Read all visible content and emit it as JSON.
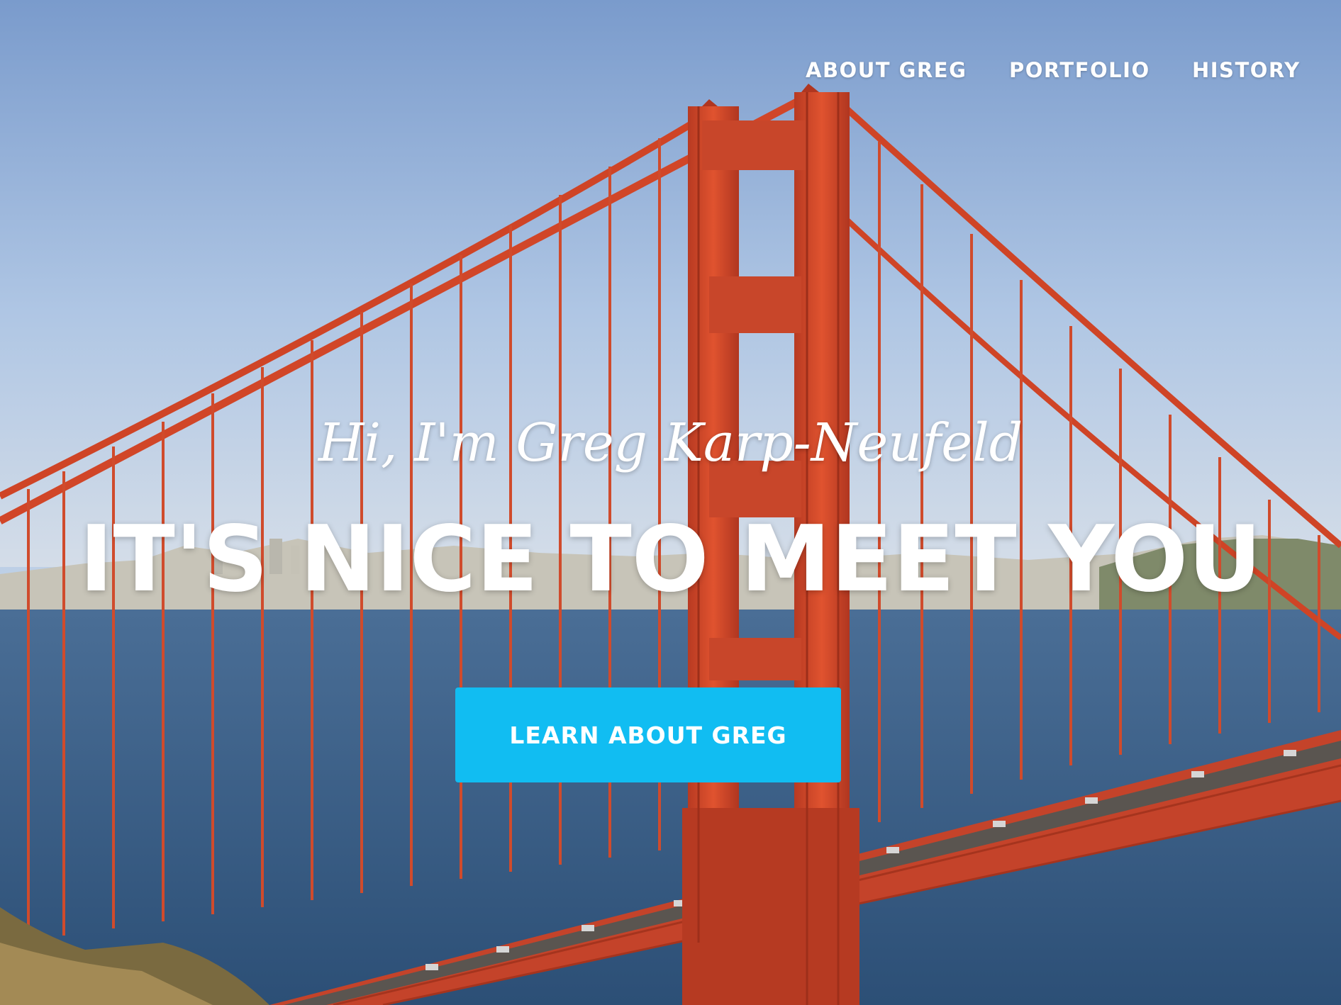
{
  "nav": {
    "items": [
      {
        "label": "ABOUT GREG"
      },
      {
        "label": "PORTFOLIO"
      },
      {
        "label": "HISTORY"
      }
    ]
  },
  "hero": {
    "intro": "Hi, I'm Greg Karp-Neufeld",
    "headline": "IT'S NICE TO MEET YOU",
    "cta_label": "LEARN ABOUT GREG"
  },
  "colors": {
    "accent": "#11bdf2",
    "bridge": "#d2482a",
    "sky": "#9bb6da",
    "water": "#35587f"
  }
}
